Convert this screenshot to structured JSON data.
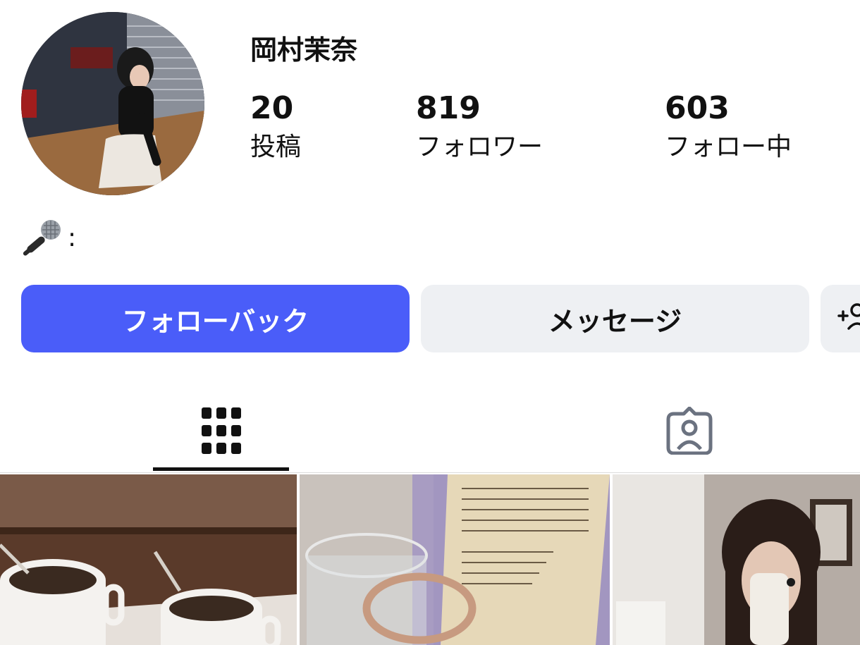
{
  "profile": {
    "display_name": "岡村茉奈",
    "bio_emoji": "microphone-icon",
    "bio_text": ":"
  },
  "stats": {
    "posts": {
      "count": "20",
      "label": "投稿"
    },
    "followers": {
      "count": "819",
      "label": "フォロワー"
    },
    "following": {
      "count": "603",
      "label": "フォロー中"
    }
  },
  "actions": {
    "follow_back_label": "フォローバック",
    "message_label": "メッセージ",
    "more_icon": "add-person-icon"
  },
  "tabs": [
    {
      "icon": "grid-icon",
      "selected": true
    },
    {
      "icon": "tagged-person-icon",
      "selected": false
    }
  ],
  "colors": {
    "primary_button": "#4a5df9",
    "secondary_button": "#eef0f3",
    "text": "#111111",
    "tab_icon_inactive": "#6b7280"
  },
  "posts": [
    {
      "subject": "two cups of iced coffee on a tray"
    },
    {
      "subject": "glass cup with bracelet and a book page"
    },
    {
      "subject": "mirror selfie with phone case"
    }
  ]
}
